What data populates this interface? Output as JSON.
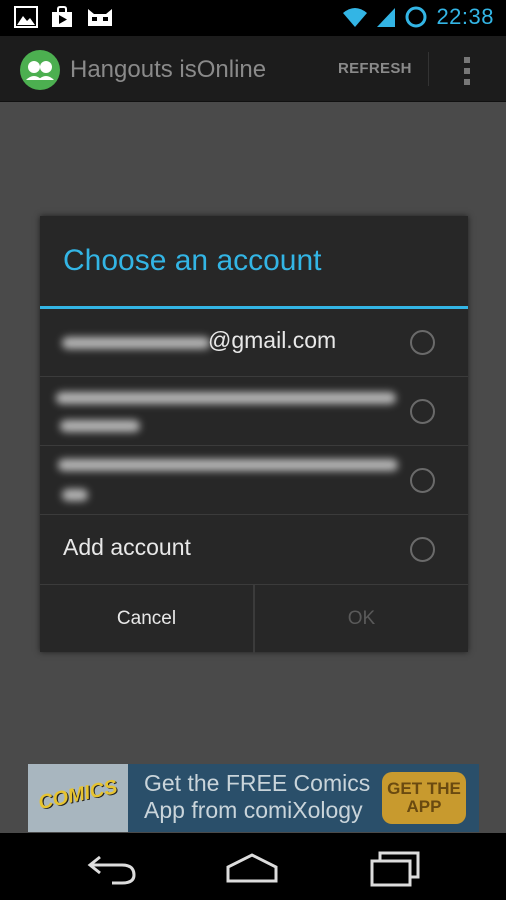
{
  "status_bar": {
    "time": "22:38",
    "notification_icons": [
      "image-icon",
      "play-store-icon",
      "cyanogen-cat-icon"
    ],
    "system_icons": [
      "wifi-icon",
      "signal-icon",
      "sync-circle-icon"
    ],
    "accent_color": "#33b5e5"
  },
  "action_bar": {
    "title": "Hangouts isOnline",
    "refresh_label": "REFRESH",
    "overflow_icon": "overflow-menu-icon",
    "app_icon": "hangouts-icon"
  },
  "dialog": {
    "title": "Choose an account",
    "accounts": [
      {
        "label_suffix": "@gmail.com",
        "redacted": true,
        "selected": false
      },
      {
        "label_suffix": "",
        "redacted": true,
        "selected": false
      },
      {
        "label_suffix": "",
        "redacted": true,
        "selected": false
      }
    ],
    "add_account_label": "Add account",
    "cancel_label": "Cancel",
    "ok_label": "OK",
    "ok_enabled": false
  },
  "ad": {
    "logo_text": "COMICS",
    "line1": "Get the FREE Comics",
    "line2": "App from comiXology",
    "cta_line1": "GET THE",
    "cta_line2": "APP"
  },
  "nav_bar": {
    "buttons": [
      "back-icon",
      "home-icon",
      "recents-icon"
    ]
  }
}
